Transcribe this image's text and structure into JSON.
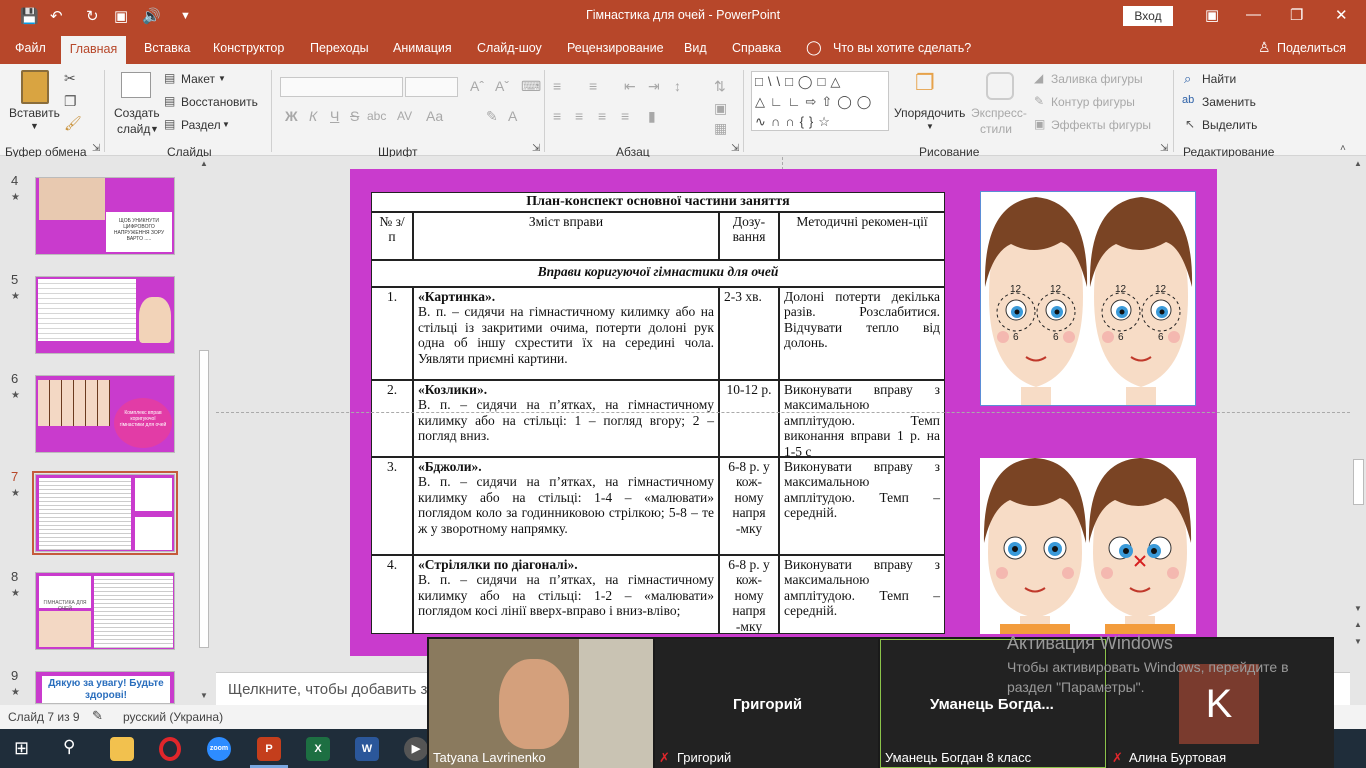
{
  "window": {
    "title": "Гімнастика для очей  -  PowerPoint",
    "signin": "Вход",
    "quick_access": [
      "save-icon",
      "undo-icon",
      "redo-icon",
      "present-icon",
      "audio-icon",
      "customize-icon"
    ]
  },
  "tabs": [
    "Файл",
    "Главная",
    "Вставка",
    "Конструктор",
    "Переходы",
    "Анимация",
    "Слайд-шоу",
    "Рецензирование",
    "Вид",
    "Справка"
  ],
  "tell_me": "Что вы хотите сделать?",
  "share": "Поделиться",
  "ribbon": {
    "clipboard": {
      "paste": "Вставить",
      "group": "Буфер обмена"
    },
    "slides": {
      "new_slide_line1": "Создать",
      "new_slide_line2": "слайд",
      "layout": "Макет",
      "reset": "Восстановить",
      "section": "Раздел",
      "group": "Слайды"
    },
    "font": {
      "bold": "Ж",
      "italic": "К",
      "underline": "Ч",
      "strike": "S",
      "shadow": "abc",
      "spacing": "AV",
      "case": "Aa",
      "color": "A",
      "group": "Шрифт"
    },
    "paragraph": {
      "group": "Абзац"
    },
    "drawing": {
      "arrange": "Упорядочить",
      "quick_styles_line1": "Экспресс-",
      "quick_styles_line2": "стили",
      "fill": "Заливка фигуры",
      "outline": "Контур фигуры",
      "effects": "Эффекты фигуры",
      "group": "Рисование"
    },
    "editing": {
      "find": "Найти",
      "replace": "Заменить",
      "select": "Выделить",
      "group": "Редактирование"
    }
  },
  "thumbnails": [
    {
      "num": "4",
      "text": "ЩОБ УНИКНУТИ ЦИФРОВОГО НАПРУЖЕННЯ ЗОРУ ВАРТО ....."
    },
    {
      "num": "5",
      "text": ""
    },
    {
      "num": "6",
      "text": "Комплекс вправ коригуючої гімнастики для очей"
    },
    {
      "num": "7",
      "text": ""
    },
    {
      "num": "8",
      "text": "ГІМНАСТИКА ДЛЯ ОЧЕЙ"
    },
    {
      "num": "9",
      "text": "Дякую за увагу! Будьте здорові!"
    }
  ],
  "slide": {
    "table_title": "План-конспект основної частини заняття",
    "headers": [
      "№ з/п",
      "Зміст вправи",
      "Дозу-вання",
      "Методичні рекомен-ції"
    ],
    "section": "Вправи коригуючої гімнастики для очей",
    "rows": [
      {
        "num": "1.",
        "name": "«Картинка».",
        "text": "В. п. – сидячи на гімнастичному килимку або на стільці із закритими очима, потерти долоні рук одна об іншу схрестити їх на середині чола. Уявляти приємні картини.",
        "dose": "2-3 хв.",
        "notes": "Долоні потерти декілька разів. Розслабитися. Відчувати тепло від долонь."
      },
      {
        "num": "2.",
        "name": "«Козлики».",
        "text": "В. п. – сидячи на п’ятках, на гімнастичному килимку або на стільці: 1 – погляд вгору; 2 – погляд вниз.",
        "dose": "10-12 р.",
        "notes": "Виконувати вправу з максимальною амплітудою. Темп виконання вправи 1 р. на 1-5 с"
      },
      {
        "num": "3.",
        "name": "«Бджоли».",
        "text": "В. п. – сидячи на п’ятках, на гімнастичному килимку або на стільці: 1-4 – «малювати» поглядом коло за годинниковою стрілкою; 5-8 – те ж у зворотному напрямку.",
        "dose": "6-8 р. у кож-ному напря -мку",
        "notes": "Виконувати вправу з максимальною амплітудою. Темп – середній."
      },
      {
        "num": "4.",
        "name": "«Стрілялки по діагоналі».",
        "text": "В. п. – сидячи на п’ятках, на гімнастичному килимку або на стільці: 1-2 – «малювати» поглядом косі лінії вверх-вправо і вниз-вліво;",
        "dose": "6-8 р. у кож-ному напря -мку",
        "notes": "Виконувати вправу з максимальною амплітудою. Темп – середній."
      }
    ],
    "clock_labels": [
      "12",
      "6",
      "12",
      "6",
      "12",
      "6",
      "12",
      "6"
    ]
  },
  "notes_placeholder": "Щелкните, чтобы добавить за",
  "status": {
    "slide": "Слайд 7 из 9",
    "language": "русский (Украина)"
  },
  "video": {
    "participants": [
      {
        "name": "Tatyana Lavrinenko",
        "label": ""
      },
      {
        "name": "Григорий",
        "label": "Григорий"
      },
      {
        "name": "Уманець Богдан 8 класс",
        "label": "Уманець  Богда..."
      },
      {
        "name": "Алина Буртовая",
        "label": "",
        "initial": "K"
      }
    ]
  },
  "watermark": {
    "title": "Активация Windows",
    "text": "Чтобы активировать Windows, перейдите в раздел \"Параметры\"."
  },
  "colors": {
    "accent": "#b7472a",
    "slide_bg": "#c93bcd",
    "taskbar": "#1f2d3a"
  }
}
